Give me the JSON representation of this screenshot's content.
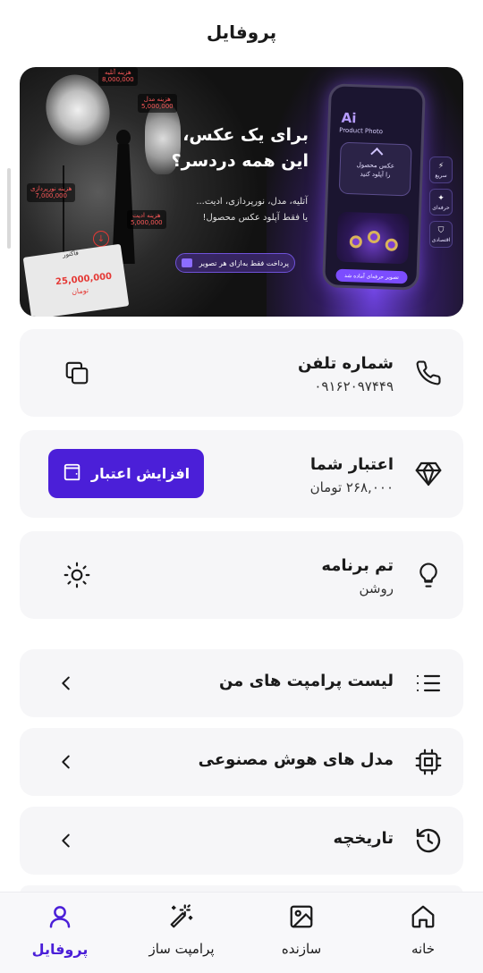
{
  "header": {
    "title": "پروفایل"
  },
  "banner": {
    "headline_line1": "برای یک عکس،",
    "headline_line2": "این همه دردسر؟",
    "subline_line1": "آتلیه، مدل، نورپردازی، ادیت...",
    "subline_line2": "یا فقط آپلود عکس محصول!",
    "pay_label": "پرداخت فقط به‌ازای هر تصویر",
    "paper_amount": "25,000,000",
    "paper_unit": "تومان",
    "paper_title": "فاکتور",
    "price_tags": [
      {
        "label": "هزینه آتلیه",
        "value": "8,000,000"
      },
      {
        "label": "هزینه مدل",
        "value": "5,000,000"
      },
      {
        "label": "هزینه نورپردازی",
        "value": "7,000,000"
      },
      {
        "label": "هزینه ادیت",
        "value": "5,000,000"
      }
    ],
    "phone": {
      "logo": "Ai",
      "logo_sub": "Product Photo",
      "upload_title": "عکس محصول",
      "upload_sub": "را آپلود کنید",
      "cta": "تصویر حرفه‌ای آماده شد"
    },
    "features": [
      {
        "label": "سریع",
        "icon": "bolt-icon"
      },
      {
        "label": "حرفه‌ای",
        "icon": "sparkle-icon"
      },
      {
        "label": "اقتصادی",
        "icon": "shield-icon"
      }
    ]
  },
  "phone_card": {
    "title": "شماره تلفن",
    "value": "۰۹۱۶۲۰۹۷۴۴۹",
    "icon": "phone-icon",
    "action_icon": "copy-icon"
  },
  "credit_card": {
    "title": "اعتبار شما",
    "value": "۲۶۸,۰۰۰ تومان",
    "icon": "diamond-icon",
    "button_label": "افزایش اعتبار",
    "button_icon": "wallet-icon",
    "accent": "#4b1fd8"
  },
  "theme_card": {
    "title": "تم برنامه",
    "value": "روشن",
    "icon": "lightbulb-icon",
    "action_icon": "sun-icon"
  },
  "menu": [
    {
      "label": "لیست پرامپت های من",
      "icon": "list-icon"
    },
    {
      "label": "مدل های هوش مصنوعی",
      "icon": "chip-icon"
    },
    {
      "label": "تاریخچه",
      "icon": "history-icon"
    }
  ],
  "bottom_nav": [
    {
      "label": "خانه",
      "icon": "home-icon",
      "active": false
    },
    {
      "label": "سازنده",
      "icon": "image-icon",
      "active": false
    },
    {
      "label": "پرامپت ساز",
      "icon": "magic-wand-icon",
      "active": false
    },
    {
      "label": "پروفایل",
      "icon": "user-icon",
      "active": true
    }
  ]
}
